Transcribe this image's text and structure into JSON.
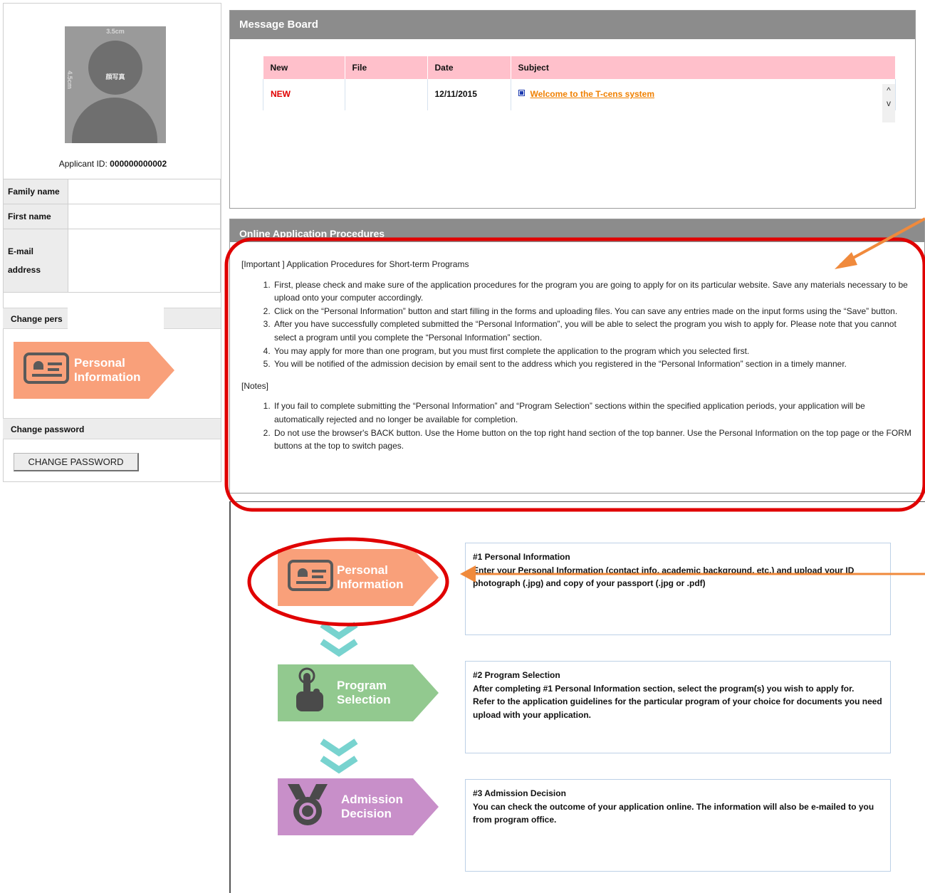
{
  "photo": {
    "width_label": "3.5cm",
    "height_label": "4.5cm",
    "caption": "顔写真"
  },
  "applicant": {
    "label": "Applicant ID:",
    "id": "000000000002"
  },
  "profile": {
    "family_name_label": "Family name",
    "first_name_label": "First name",
    "email_label_1": "E-mail",
    "email_label_2": "address"
  },
  "sidebar": {
    "change_personal_label": "Change pers",
    "personal_info_line1": "Personal",
    "personal_info_line2": "Information",
    "change_password_label": "Change password",
    "change_password_button": "CHANGE PASSWORD"
  },
  "message_board": {
    "title": "Message Board",
    "columns": [
      "New",
      "File",
      "Date",
      "Subject"
    ],
    "rows": [
      {
        "new": "NEW",
        "file": "",
        "date": "12/11/2015",
        "subject": "Welcome to the T-cens system"
      }
    ],
    "scroll_up": "^",
    "scroll_down": "v"
  },
  "procedures": {
    "title": "Online Application Procedures",
    "important_heading": "[Important ] Application Procedures for Short-term Programs",
    "steps": [
      "First, please check and make sure of the application procedures for the program you are going to apply for on its particular website. Save any materials necessary to be upload onto your computer accordingly.",
      "Click on the “Personal Information” button and start filling in the forms and uploading files. You can save any entries made on the input forms using the “Save” button.",
      "After you have successfully completed submitted the “Personal Information”, you will be able to select the program you wish to apply for. Please note that you cannot select a program until you complete the “Personal Information” section.",
      "You may apply for more than one program, but you must first complete the application to the program which you selected first.",
      "You will be notified of the admission decision by email sent to the address which you registered in the “Personal Information” section in a timely manner."
    ],
    "notes_heading": "[Notes]",
    "notes": [
      "If you fail to complete submitting the “Personal Information” and “Program Selection” sections within the specified application periods, your application will be automatically rejected and no longer be available for completion.",
      "Do not use the browser's BACK button. Use the Home button on the top right hand section of the top banner. Use the Personal Information on the top page or the FORM buttons at the top to switch pages."
    ]
  },
  "flow": {
    "personal": {
      "line1": "Personal",
      "line2": "Information",
      "title": "#1 Personal Information",
      "desc": "Enter your Personal Information (contact info, academic background, etc.) and upload your ID photograph (.jpg) and copy of your passport (.jpg or .pdf)"
    },
    "program": {
      "line1": "Program",
      "line2": "Selection",
      "title": "#2 Program Selection",
      "desc1": "After completing #1 Personal Information section, select the program(s) you wish to apply for.",
      "desc2": "Refer to the application guidelines for the particular program of your choice for documents you need upload with your application."
    },
    "admission": {
      "line1": "Admission",
      "line2": "Decision",
      "title": "#3 Admission Decision",
      "desc": "You can check the outcome of your application online. The information will also be e-mailed to you from program office."
    }
  },
  "colors": {
    "personal": "#f9a07a",
    "program": "#92c98f",
    "admission": "#c88fc9",
    "chevron": "#78d3cf",
    "highlight": "#e00000",
    "pointer": "#f08a3c"
  }
}
